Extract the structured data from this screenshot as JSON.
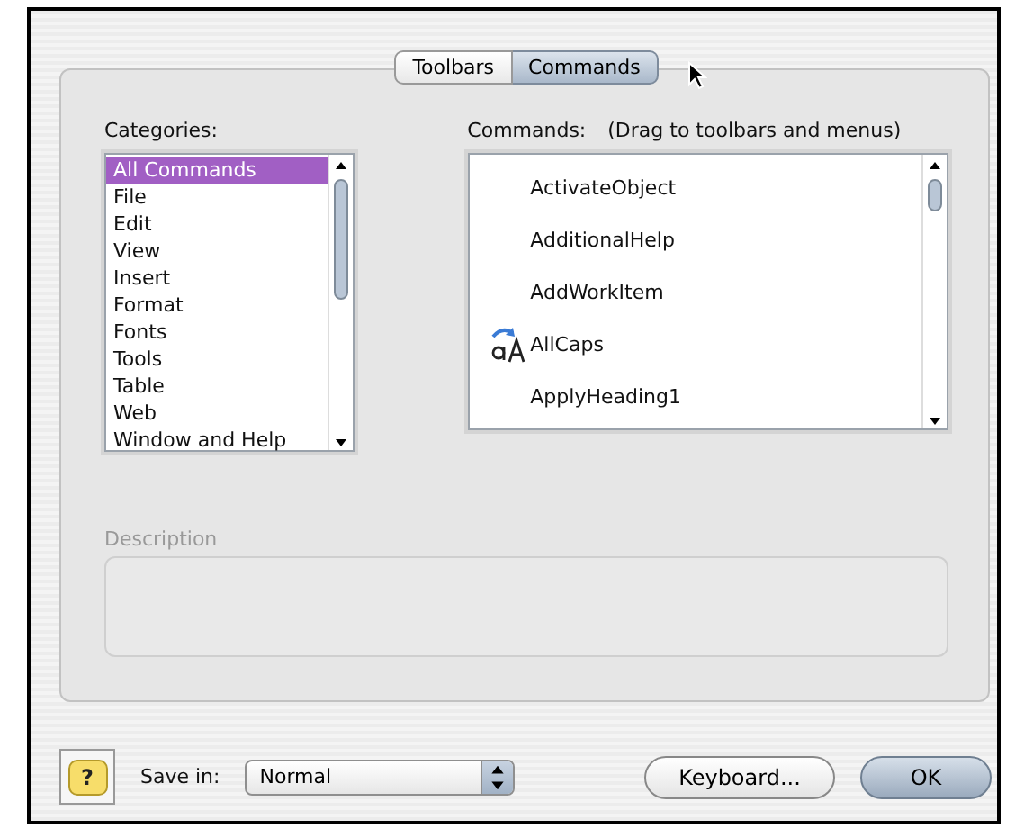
{
  "tabs": [
    {
      "label": "Toolbars",
      "selected": false
    },
    {
      "label": "Commands",
      "selected": true
    }
  ],
  "categories": {
    "label": "Categories:",
    "items": [
      {
        "label": "All Commands",
        "selected": true
      },
      {
        "label": "File",
        "selected": false
      },
      {
        "label": "Edit",
        "selected": false
      },
      {
        "label": "View",
        "selected": false
      },
      {
        "label": "Insert",
        "selected": false
      },
      {
        "label": "Format",
        "selected": false
      },
      {
        "label": "Fonts",
        "selected": false
      },
      {
        "label": "Tools",
        "selected": false
      },
      {
        "label": "Table",
        "selected": false
      },
      {
        "label": "Web",
        "selected": false
      },
      {
        "label": "Window and Help",
        "selected": false
      }
    ]
  },
  "commands": {
    "label": "Commands:",
    "hint": "(Drag to toolbars and menus)",
    "items": [
      {
        "label": "ActivateObject",
        "kind": "plain"
      },
      {
        "label": "AdditionalHelp",
        "kind": "plain"
      },
      {
        "label": "AddWorkItem",
        "kind": "plain"
      },
      {
        "label": "AllCaps",
        "kind": "icon"
      },
      {
        "label": "ApplyHeading1",
        "kind": "plain"
      }
    ]
  },
  "description": {
    "label": "Description",
    "disabled": true
  },
  "help_button": "?",
  "save_in": {
    "label": "Save in:",
    "value": "Normal"
  },
  "buttons": [
    {
      "label": "Keyboard...",
      "default": false
    },
    {
      "label": "OK",
      "default": true
    }
  ]
}
